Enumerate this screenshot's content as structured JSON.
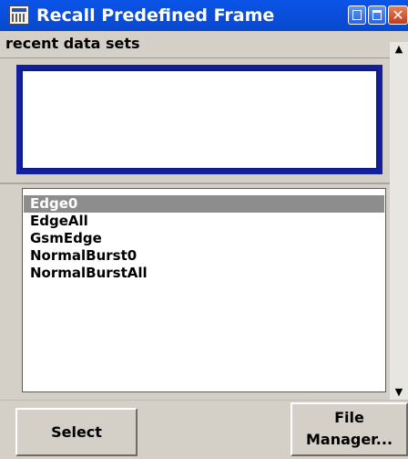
{
  "window": {
    "title": "Recall Predefined Frame",
    "title_icon": "table-icon",
    "controls": {
      "minimize_icon": "minimize-icon",
      "maximize_icon": "maximize-icon",
      "close_icon": "close-icon",
      "close_glyph": "✕"
    }
  },
  "recent": {
    "label": "recent data sets"
  },
  "files": {
    "items": [
      "Edge0",
      "EdgeAll",
      "GsmEdge",
      "NormalBurst0",
      "NormalBurstAll"
    ],
    "selected": "Edge0"
  },
  "scrollbar": {
    "up_glyph": "▲",
    "down_glyph": "▼"
  },
  "buttons": {
    "select_label": "Select",
    "file_manager_line1": "File",
    "file_manager_line2": "Manager..."
  },
  "colors": {
    "titlebar": "#0a54e8",
    "focus_border": "#13209e",
    "selection": "#8d8d8d",
    "dialog_bg": "#d4d0c8"
  }
}
